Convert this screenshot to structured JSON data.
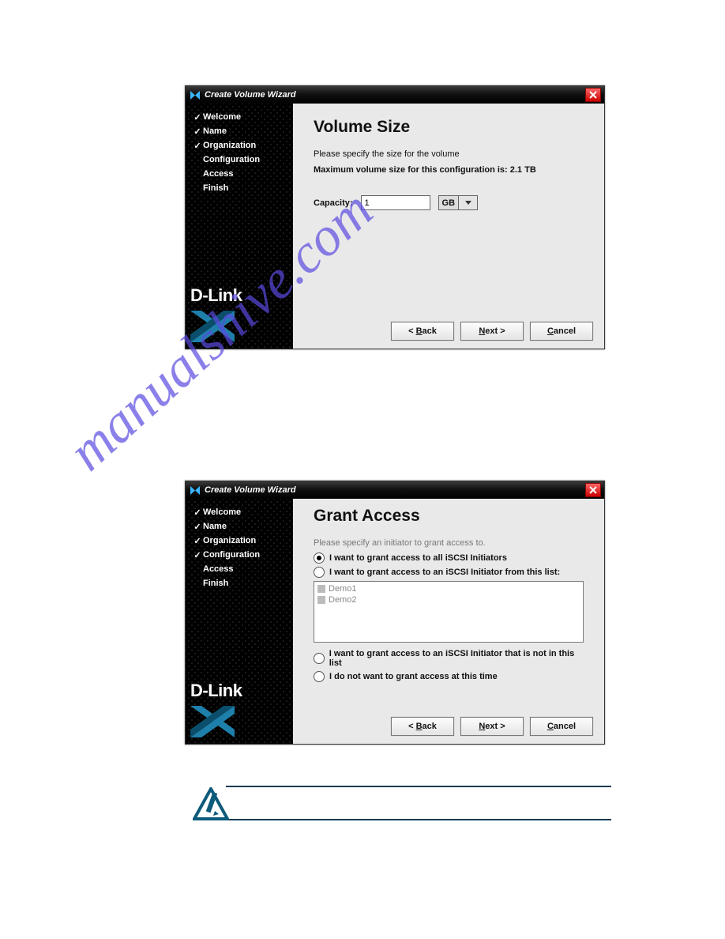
{
  "wizard1": {
    "title": "Create Volume Wizard",
    "steps": [
      {
        "label": "Welcome",
        "done": true
      },
      {
        "label": "Name",
        "done": true
      },
      {
        "label": "Organization",
        "done": true
      },
      {
        "label": "Configuration",
        "done": false
      },
      {
        "label": "Access",
        "done": false
      },
      {
        "label": "Finish",
        "done": false
      }
    ],
    "brand": "D-Link",
    "heading": "Volume Size",
    "instruction": "Please specify the size for the volume",
    "max_line": "Maximum volume size for this configuration is:  2.1 TB",
    "capacity_label": "Capacity:",
    "capacity_value": "1",
    "capacity_unit": "GB",
    "back": "< Back",
    "next": "Next >",
    "cancel": "Cancel"
  },
  "wizard2": {
    "title": "Create Volume Wizard",
    "steps": [
      {
        "label": "Welcome",
        "done": true
      },
      {
        "label": "Name",
        "done": true
      },
      {
        "label": "Organization",
        "done": true
      },
      {
        "label": "Configuration",
        "done": true
      },
      {
        "label": "Access",
        "done": false
      },
      {
        "label": "Finish",
        "done": false
      }
    ],
    "brand": "D-Link",
    "heading": "Grant Access",
    "instruction": "Please specify an initiator to grant access to.",
    "opt_all": "I want to grant access to all iSCSI Initiators",
    "opt_list": "I want to grant access to an iSCSI Initiator from this list:",
    "initiators": [
      "Demo1",
      "Demo2"
    ],
    "opt_not_in_list": "I want to grant access to an iSCSI Initiator that is not in this list",
    "opt_none": "I do not want to grant access at this time",
    "back": "< Back",
    "next": "Next >",
    "cancel": "Cancel"
  },
  "watermark": "manualshive.com"
}
